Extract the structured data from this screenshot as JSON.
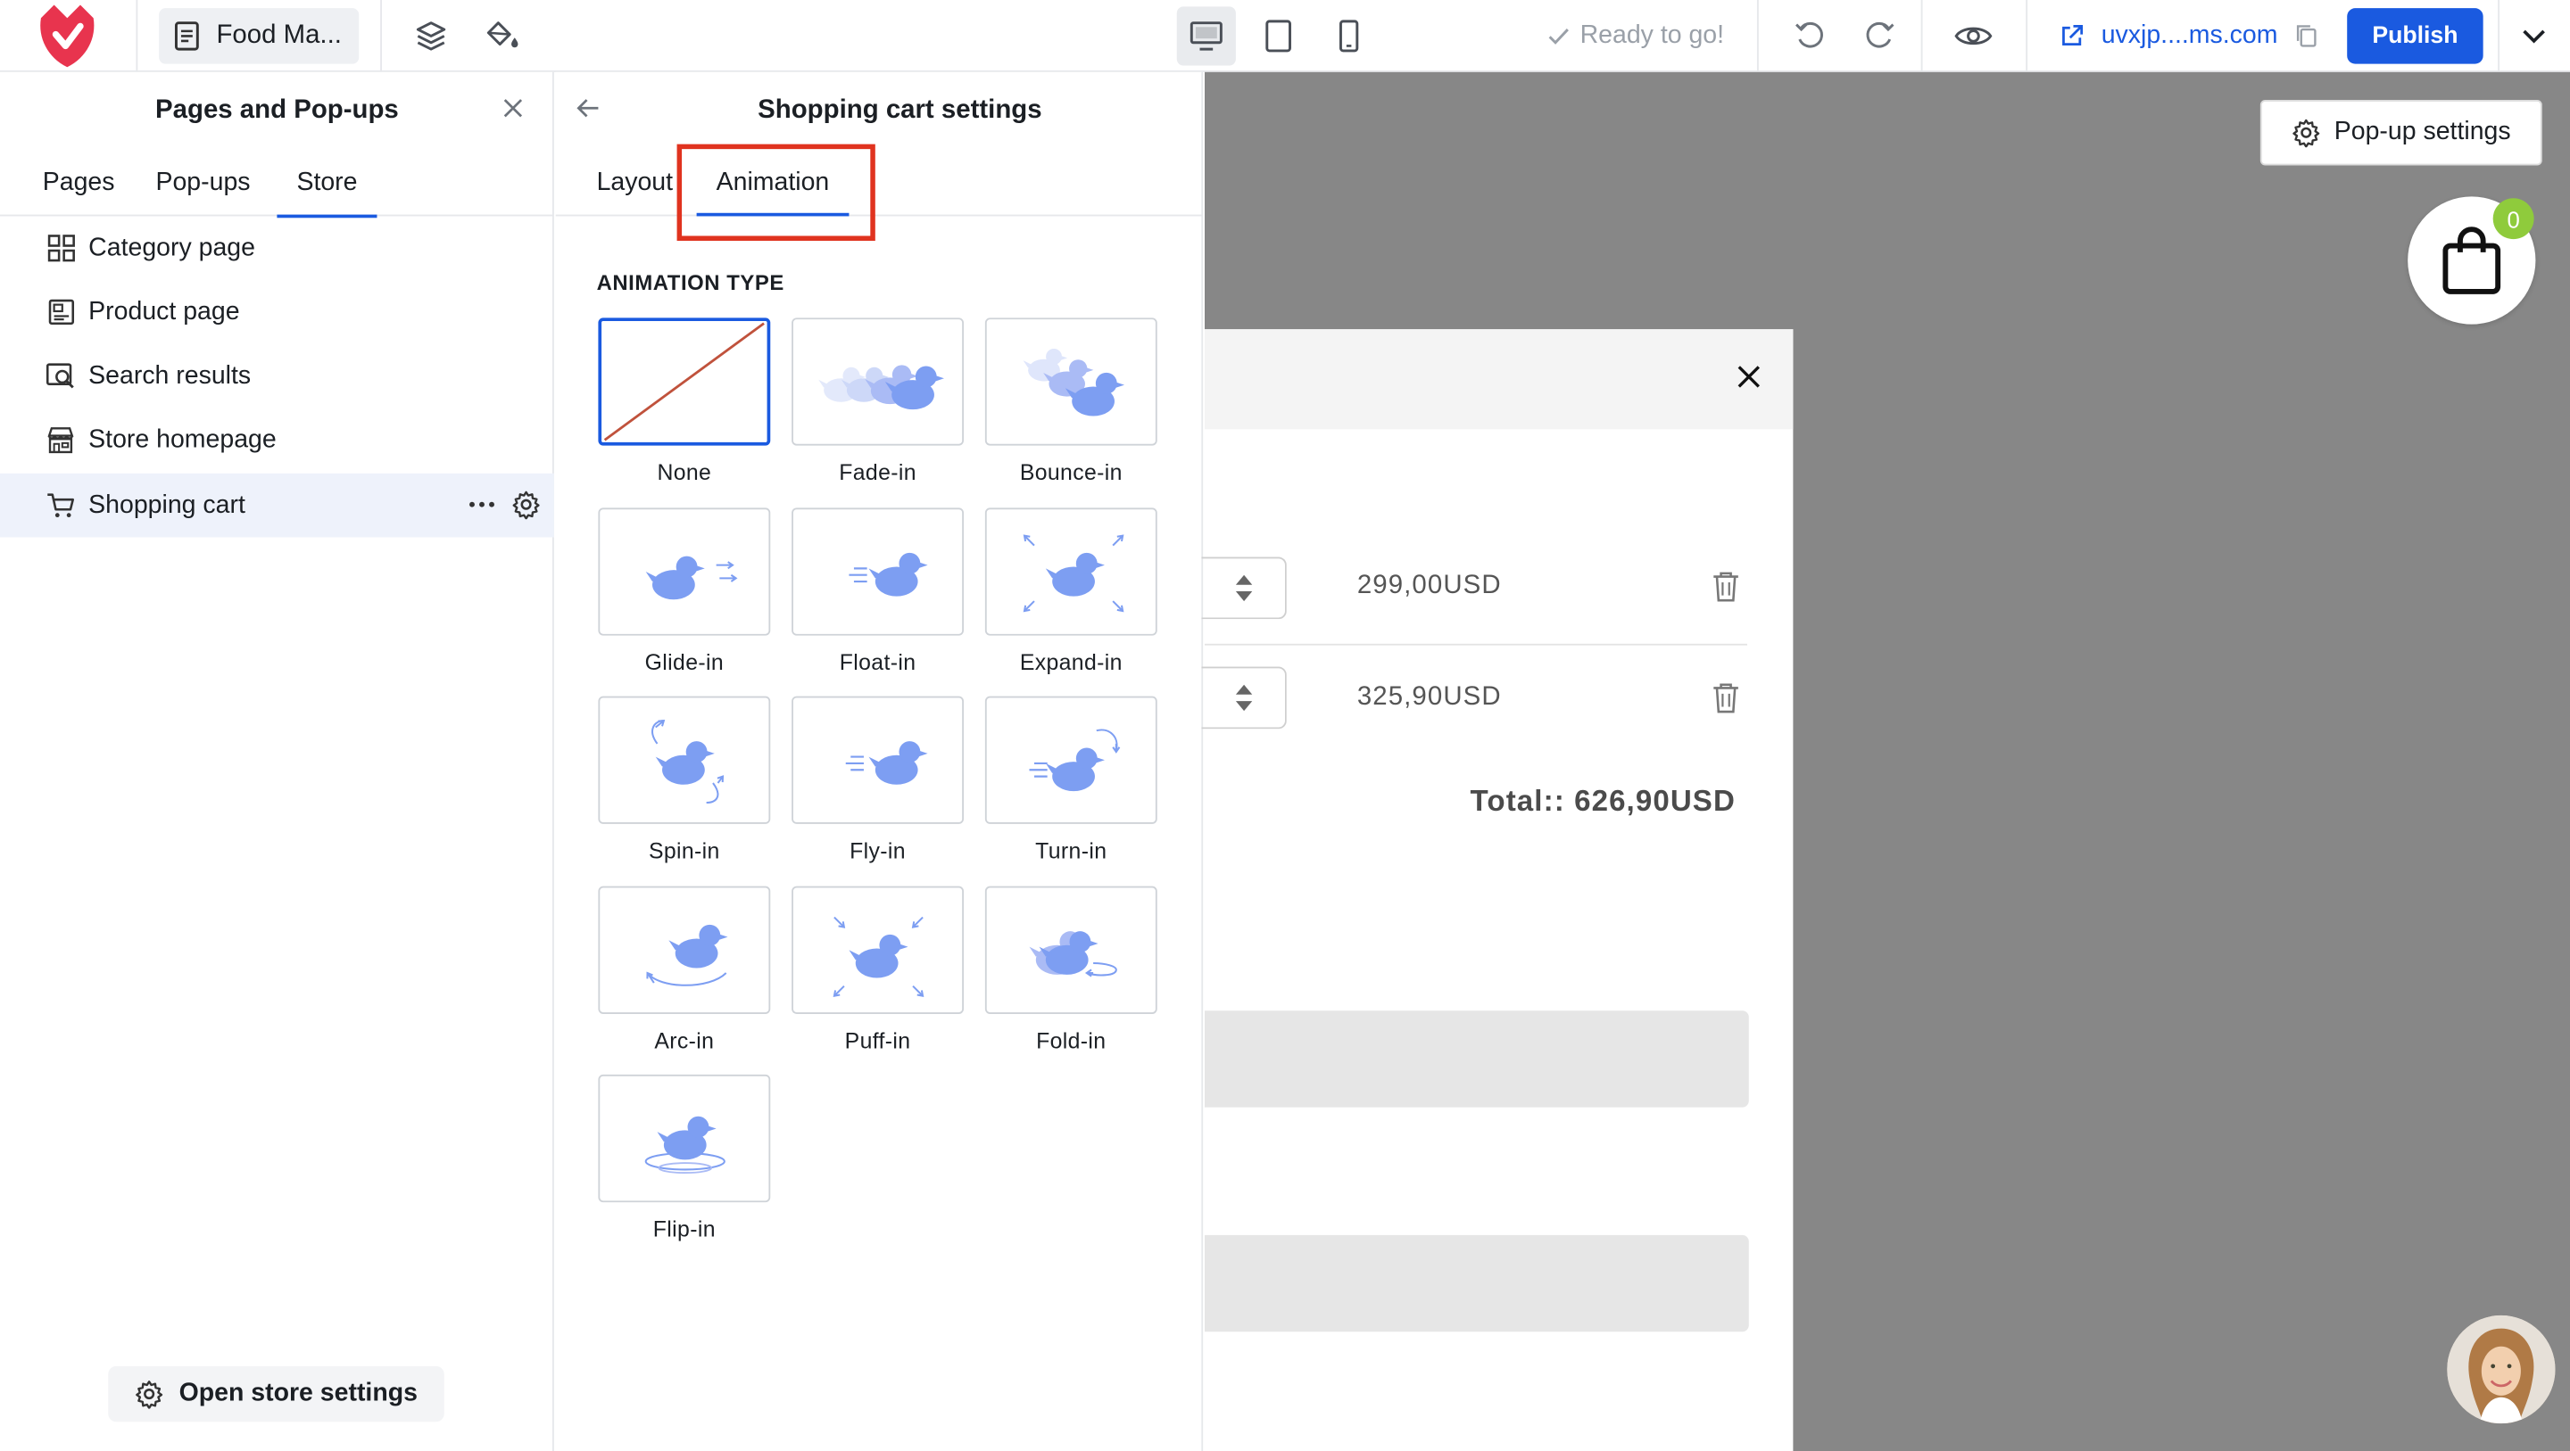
{
  "topbar": {
    "page_name": "Food Ma...",
    "status": "Ready to go!",
    "domain": "uvxjp....ms.com",
    "publish_label": "Publish"
  },
  "left_panel": {
    "title": "Pages and Pop-ups",
    "tabs": [
      "Pages",
      "Pop-ups",
      "Store"
    ],
    "active_tab": "Store",
    "items": [
      {
        "label": "Category page",
        "icon": "grid-icon"
      },
      {
        "label": "Product page",
        "icon": "product-page-icon"
      },
      {
        "label": "Search results",
        "icon": "search-results-icon"
      },
      {
        "label": "Store homepage",
        "icon": "store-icon"
      },
      {
        "label": "Shopping cart",
        "icon": "cart-icon"
      }
    ],
    "selected_item": "Shopping cart",
    "store_settings_label": "Open store settings"
  },
  "settings_panel": {
    "title": "Shopping cart settings",
    "tabs": [
      "Layout",
      "Animation"
    ],
    "active_tab": "Animation",
    "section_label": "ANIMATION TYPE",
    "animations": [
      "None",
      "Fade-in",
      "Bounce-in",
      "Glide-in",
      "Float-in",
      "Expand-in",
      "Spin-in",
      "Fly-in",
      "Turn-in",
      "Arc-in",
      "Puff-in",
      "Fold-in",
      "Flip-in"
    ],
    "selected_animation": "None"
  },
  "canvas": {
    "popup_settings_label": "Pop-up settings",
    "cart_count": "0",
    "items": [
      {
        "price": "299,00USD"
      },
      {
        "price": "325,90USD"
      }
    ],
    "total": "Total::  626,90USD"
  },
  "colors": {
    "accent": "#1a5ae0",
    "highlight": "#e0331f",
    "duck": "#7d9ef2",
    "canvas_bg": "#878787",
    "badge": "#8fcb3c"
  }
}
